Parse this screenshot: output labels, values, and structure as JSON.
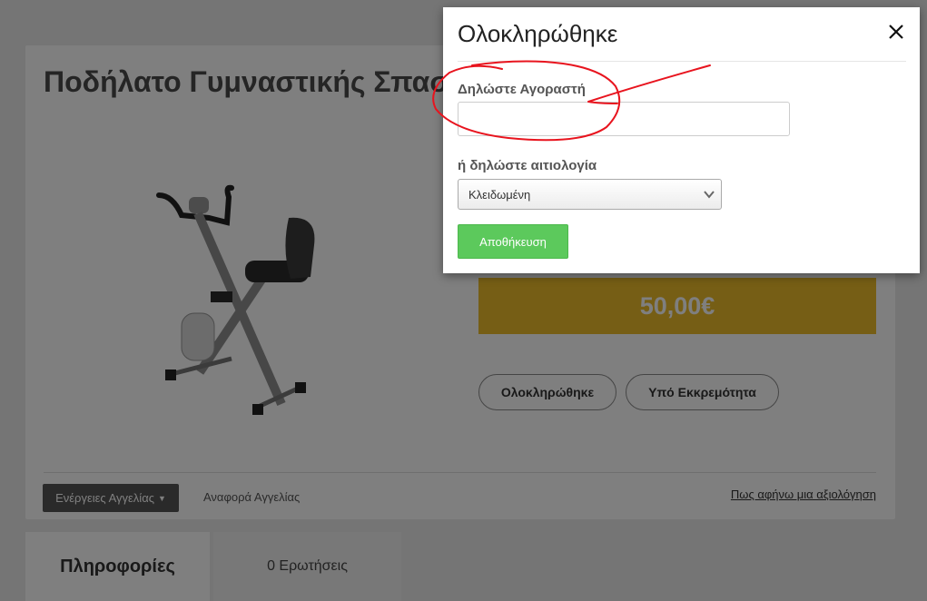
{
  "listing": {
    "title": "Ποδήλατο Γυμναστικής Σπασ",
    "price": "50,00€",
    "status_buttons": {
      "completed": "Ολοκληρώθηκε",
      "pending": "Υπό Εκκρεμότητα"
    },
    "actions_label": "Ενέργειες Αγγελίας",
    "report_label": "Αναφορά Αγγελίας",
    "review_link": "Πως αφήνω μια αξιολόγηση"
  },
  "tabs": {
    "info": "Πληροφορίες",
    "questions": "0 Ερωτήσεις"
  },
  "modal": {
    "title": "Ολοκληρώθηκε",
    "buyer_label": "Δηλώστε Αγοραστή",
    "buyer_value": "",
    "reason_label": "ή δηλώστε αιτιολογία",
    "reason_selected": "Κλειδωμένη",
    "save_label": "Αποθήκευση"
  },
  "colors": {
    "price_bg": "#ecbd2b",
    "save_bg": "#5cc95c",
    "annotation": "#e8141e"
  }
}
